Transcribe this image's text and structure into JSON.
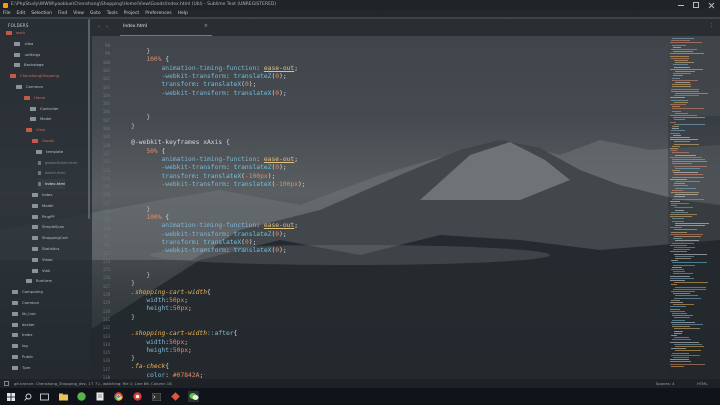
{
  "window": {
    "title": "E:\\PhpStudy\\WWW\\yaoblue\\Chenshang\\Shopping\\Home\\View\\Goods\\Index.html (Ubl) - Sublime Text (UNREGISTERED)",
    "controls": [
      "minimize-icon",
      "maximize-icon",
      "close-icon"
    ]
  },
  "menu": [
    "File",
    "Edit",
    "Selection",
    "Find",
    "View",
    "Goto",
    "Tools",
    "Project",
    "Preferences",
    "Help"
  ],
  "sidebar": {
    "header": "FOLDERS",
    "items": [
      {
        "label": "work",
        "state": "open-red"
      },
      {
        "label": ".idea",
        "state": "closed"
      },
      {
        "label": ".settings",
        "state": "closed"
      },
      {
        "label": "Backstage",
        "state": "closed"
      },
      {
        "label": "ChenshangShopping",
        "state": "open-red"
      },
      {
        "label": "Common",
        "state": "closed"
      },
      {
        "label": "Home",
        "state": "open-red"
      },
      {
        "label": "Controller",
        "state": "closed"
      },
      {
        "label": "Model",
        "state": "closed"
      },
      {
        "label": "View",
        "state": "open-red"
      },
      {
        "label": "Goods",
        "state": "open-red"
      },
      {
        "label": "template",
        "state": "closed"
      },
      {
        "label": "goodsDetail.html",
        "state": "file-dim"
      },
      {
        "label": "detail.html",
        "state": "file-dim"
      },
      {
        "label": "Index.html",
        "state": "file-selected"
      },
      {
        "label": "Index",
        "state": "closed"
      },
      {
        "label": "Model",
        "state": "closed"
      },
      {
        "label": "PingPP",
        "state": "closed"
      },
      {
        "label": "SimpleScan",
        "state": "closed"
      },
      {
        "label": "ShoppingCart",
        "state": "closed"
      },
      {
        "label": "Statistics",
        "state": "closed"
      },
      {
        "label": "Vistor",
        "state": "closed"
      },
      {
        "label": "Vistl",
        "state": "closed"
      },
      {
        "label": "Runtime",
        "state": "closed"
      },
      {
        "label": "Computing",
        "state": "closed"
      },
      {
        "label": "Common",
        "state": "closed"
      },
      {
        "label": "lib_hub",
        "state": "closed"
      },
      {
        "label": "docker",
        "state": "closed"
      },
      {
        "label": "Index",
        "state": "closed"
      },
      {
        "label": "log",
        "state": "closed"
      },
      {
        "label": "Public",
        "state": "closed"
      },
      {
        "label": "Tpm",
        "state": "closed"
      }
    ]
  },
  "tabs": [
    {
      "label": "Index.html",
      "close": "×"
    }
  ],
  "editor": {
    "line_numbers": [
      "98",
      "99",
      "100",
      "101",
      "102",
      "103",
      "104",
      "105",
      "106",
      "107",
      "108",
      "109",
      "110",
      "111",
      "112",
      "113",
      "114",
      "115",
      "116",
      "117",
      "118",
      "119",
      "120",
      "121",
      "122",
      "123",
      "124",
      "125",
      "126",
      "127",
      "128",
      "129",
      "130",
      "131",
      "132",
      "133",
      "134",
      "135",
      "136",
      "137",
      "138",
      "139",
      "140",
      "141"
    ]
  },
  "statusbar": {
    "left": "git branch: Chenshang_Shopping_dev, 1↑ 7↓, watching: file 1; Line 86, Column 18",
    "spaces": "Spaces: 4",
    "syntax": "HTML"
  },
  "taskbar": [
    "windows-start-icon",
    "search-icon",
    "task-view-icon",
    "file-explorer-icon",
    "evernote-icon",
    "notes-icon",
    "chrome-icon",
    "photo-icon",
    "terminal-icon",
    "sublime-icon",
    "wechat-icon"
  ]
}
